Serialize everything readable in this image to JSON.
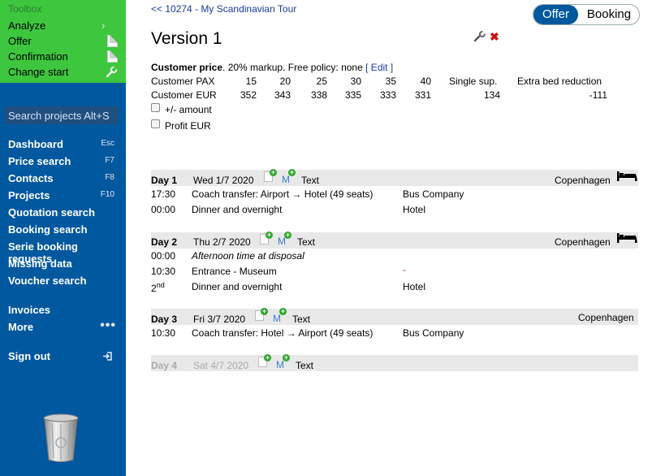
{
  "sidebar": {
    "toolbox_title": "Toolbox",
    "toolbox_items": [
      {
        "label": "Analyze",
        "icon": "chevron-right-icon"
      },
      {
        "label": "Offer",
        "icon": "document-icon"
      },
      {
        "label": "Confirmation",
        "icon": "document-icon"
      },
      {
        "label": "Change start",
        "icon": "wrench-icon"
      }
    ],
    "search_placeholder": "Search projects Alt+S",
    "nav": [
      {
        "label": "Dashboard",
        "shortcut": "Esc"
      },
      {
        "label": "Price search",
        "shortcut": "F7"
      },
      {
        "label": "Contacts",
        "shortcut": "F8"
      },
      {
        "label": "Projects",
        "shortcut": "F10"
      },
      {
        "label": "Quotation search",
        "shortcut": ""
      },
      {
        "label": "Booking search",
        "shortcut": ""
      },
      {
        "label": "Serie booking requests",
        "shortcut": ""
      },
      {
        "label": "Missing data",
        "shortcut": ""
      },
      {
        "label": "Voucher search",
        "shortcut": ""
      }
    ],
    "invoices": "Invoices",
    "more": "More",
    "more_dots": "•••",
    "signout": "Sign out"
  },
  "header": {
    "back_prefix": "<<",
    "back_link": "10274 - My Scandinavian Tour",
    "toggle_active": "Offer",
    "toggle_inactive": "Booking"
  },
  "version": {
    "title": "Version 1"
  },
  "pricing": {
    "bold_label": "Customer price",
    "text": ". 20% markup. Free policy: none",
    "edit": "[ Edit ]",
    "row1_label": "Customer PAX",
    "pax": [
      "15",
      "20",
      "25",
      "30",
      "35",
      "40"
    ],
    "single_sup_label": "Single sup.",
    "extra_bed_label": "Extra bed reduction",
    "row2_label": "Customer EUR",
    "eur": [
      "352",
      "343",
      "338",
      "335",
      "333",
      "331"
    ],
    "single_sup_value": "134",
    "extra_bed_value": "-111",
    "opt_amount": "+/- amount",
    "opt_profit": "Profit EUR"
  },
  "text_label": "Text",
  "m_label": "M",
  "days": [
    {
      "label": "Day 1",
      "date": "Wed 1/7 2020",
      "city": "Copenhagen",
      "items": [
        {
          "time": "17:30",
          "desc": "Coach transfer: Airport → Hotel (49 seats)",
          "supplier": "Bus Company"
        },
        {
          "time": "00:00",
          "desc": "Dinner and overnight",
          "supplier": "Hotel"
        }
      ]
    },
    {
      "label": "Day 2",
      "date": "Thu 2/7 2020",
      "city": "Copenhagen",
      "items": [
        {
          "time": "00:00",
          "desc": "Afternoon time at disposal",
          "supplier": ""
        },
        {
          "time": "10:30",
          "desc": "Entrance - Museum",
          "supplier": "-"
        },
        {
          "time": "2",
          "time_sup": "nd",
          "desc": "Dinner and overnight",
          "supplier": "Hotel"
        }
      ]
    },
    {
      "label": "Day 3",
      "date": "Fri 3/7 2020",
      "city": "Copenhagen",
      "items": [
        {
          "time": "10:30",
          "desc": "Coach transfer: Hotel → Airport (49 seats)",
          "supplier": "Bus Company"
        }
      ]
    },
    {
      "label": "Day 4",
      "date": "Sat 4/7 2020",
      "city": "",
      "items": []
    }
  ],
  "colors": {
    "sidebar": "#00589f",
    "toolbox": "#3ec63e",
    "link": "#1a3aa6",
    "day_header": "#e8e8e8"
  }
}
